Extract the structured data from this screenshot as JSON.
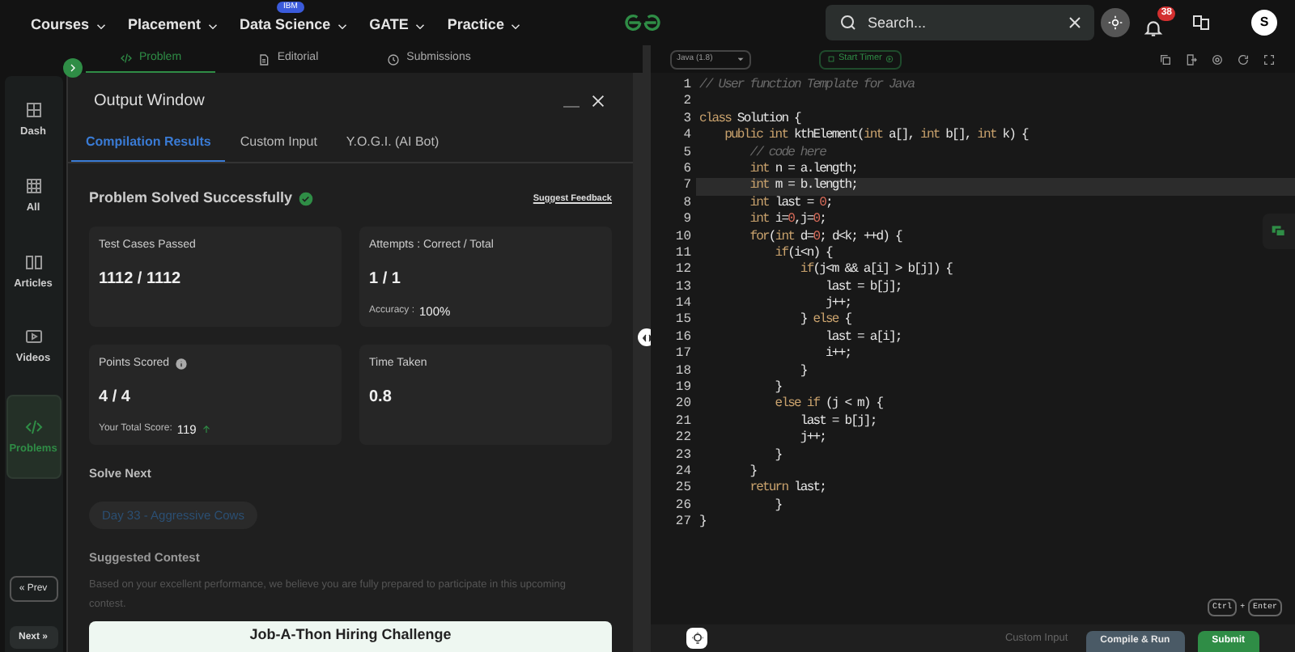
{
  "nav": {
    "items": [
      {
        "label": "Courses"
      },
      {
        "label": "Placement"
      },
      {
        "label": "Data Science",
        "badge": "IBM"
      },
      {
        "label": "GATE"
      },
      {
        "label": "Practice"
      }
    ],
    "search": {
      "placeholder": "Search..."
    },
    "notifications": "38",
    "avatar": "S"
  },
  "sidebar": {
    "items": [
      {
        "label": "Dash",
        "selected": false
      },
      {
        "label": "All",
        "selected": false
      },
      {
        "label": "Articles",
        "selected": false
      },
      {
        "label": "Videos",
        "selected": false
      },
      {
        "label": "Problems",
        "selected": true
      }
    ],
    "prev": "« Prev",
    "next": "Next »"
  },
  "problem_tabs": [
    {
      "label": "Problem",
      "selected": true
    },
    {
      "label": "Editorial",
      "selected": false
    },
    {
      "label": "Submissions",
      "selected": false
    }
  ],
  "output": {
    "title": "Output Window",
    "tabs": [
      {
        "label": "Compilation Results",
        "selected": true
      },
      {
        "label": "Custom Input",
        "selected": false
      },
      {
        "label": "Y.O.G.I. (AI Bot)",
        "selected": false
      }
    ],
    "status": "Problem Solved Successfully",
    "feedback": "Suggest Feedback",
    "cards": [
      {
        "label": "Test Cases Passed",
        "value": "1112 / 1112",
        "info": false
      },
      {
        "label": "Attempts : Correct / Total",
        "value": "1 / 1",
        "note": "Accuracy :",
        "note_value": "100%",
        "info": false
      },
      {
        "label": "Points Scored",
        "value": "4 / 4",
        "note": "Your Total Score:",
        "note_value": "119",
        "info": true
      },
      {
        "label": "Time Taken",
        "value": "0.8",
        "info": false
      }
    ],
    "solve_next_heading": "Solve Next",
    "solve_next": "Day 33 - Aggressive Cows",
    "contest_heading": "Suggested Contest",
    "contest_text": "Based on your excellent performance, we believe you are fully prepared to participate in this upcoming contest.",
    "contest_card": "Job-A-Thon Hiring Challenge"
  },
  "editor": {
    "language": "Java (1.8)",
    "timer": "Start Timer",
    "lines": [
      {
        "number": "1",
        "highlighted": false,
        "segments": [
          {
            "kind": "comment",
            "text": "// User function Template for Java"
          }
        ]
      },
      {
        "number": "2",
        "highlighted": false
      },
      {
        "number": "3",
        "highlighted": false,
        "segments": [
          {
            "kind": "keyword",
            "text": "class"
          },
          {
            "kind": "plain",
            "text": " Solution {"
          }
        ]
      },
      {
        "number": "4",
        "highlighted": false,
        "segments": [
          {
            "kind": "keyword",
            "text": "    public int"
          },
          {
            "kind": "plain",
            "text": " kthElement("
          },
          {
            "kind": "keyword",
            "text": "int"
          },
          {
            "kind": "plain",
            "text": " a[], "
          },
          {
            "kind": "keyword",
            "text": "int"
          },
          {
            "kind": "plain",
            "text": " b[], "
          },
          {
            "kind": "keyword",
            "text": "int"
          },
          {
            "kind": "plain",
            "text": " k) {"
          }
        ]
      },
      {
        "number": "5",
        "highlighted": false,
        "segments": [
          {
            "kind": "comment",
            "text": "        // code here"
          }
        ]
      },
      {
        "number": "6",
        "highlighted": false,
        "segments": [
          {
            "kind": "keyword",
            "text": "        int"
          },
          {
            "kind": "plain",
            "text": " n = a.length;"
          }
        ]
      },
      {
        "number": "7",
        "highlighted": true,
        "segments": [
          {
            "kind": "keyword",
            "text": "        int"
          },
          {
            "kind": "plain",
            "text": " m = b.length;"
          }
        ]
      },
      {
        "number": "8",
        "highlighted": false,
        "segments": [
          {
            "kind": "keyword",
            "text": "        int"
          },
          {
            "kind": "plain",
            "text": " last = "
          },
          {
            "kind": "number",
            "text": "0"
          },
          {
            "kind": "plain",
            "text": ";"
          }
        ]
      },
      {
        "number": "9",
        "highlighted": false,
        "segments": [
          {
            "kind": "keyword",
            "text": "        int"
          },
          {
            "kind": "plain",
            "text": " i="
          },
          {
            "kind": "number",
            "text": "0"
          },
          {
            "kind": "plain",
            "text": ",j="
          },
          {
            "kind": "number",
            "text": "0"
          },
          {
            "kind": "plain",
            "text": ";"
          }
        ]
      },
      {
        "number": "10",
        "highlighted": false,
        "segments": [
          {
            "kind": "keyword",
            "text": "        for"
          },
          {
            "kind": "plain",
            "text": "("
          },
          {
            "kind": "keyword",
            "text": "int"
          },
          {
            "kind": "plain",
            "text": " d="
          },
          {
            "kind": "number",
            "text": "0"
          },
          {
            "kind": "plain",
            "text": "; d<k; ++d) {"
          }
        ]
      },
      {
        "number": "11",
        "highlighted": false,
        "segments": [
          {
            "kind": "keyword",
            "text": "            if"
          },
          {
            "kind": "plain",
            "text": "(i<n) {"
          }
        ]
      },
      {
        "number": "12",
        "highlighted": false,
        "segments": [
          {
            "kind": "keyword",
            "text": "                if"
          },
          {
            "kind": "plain",
            "text": "(j<m && a[i] > b[j]) {"
          }
        ]
      },
      {
        "number": "13",
        "highlighted": false,
        "segments": [
          {
            "kind": "plain",
            "text": "                    last = b[j];"
          }
        ]
      },
      {
        "number": "14",
        "highlighted": false,
        "segments": [
          {
            "kind": "plain",
            "text": "                    j++;"
          }
        ]
      },
      {
        "number": "15",
        "highlighted": false,
        "segments": [
          {
            "kind": "plain",
            "text": "                } "
          },
          {
            "kind": "keyword",
            "text": "else"
          },
          {
            "kind": "plain",
            "text": " {"
          }
        ]
      },
      {
        "number": "16",
        "highlighted": false,
        "segments": [
          {
            "kind": "plain",
            "text": "                    last = a[i];"
          }
        ]
      },
      {
        "number": "17",
        "highlighted": false,
        "segments": [
          {
            "kind": "plain",
            "text": "                    i++;"
          }
        ]
      },
      {
        "number": "18",
        "highlighted": false,
        "segments": [
          {
            "kind": "plain",
            "text": "                }"
          }
        ]
      },
      {
        "number": "19",
        "highlighted": false,
        "segments": [
          {
            "kind": "plain",
            "text": "            }"
          }
        ]
      },
      {
        "number": "20",
        "highlighted": false,
        "segments": [
          {
            "kind": "keyword",
            "text": "            else if"
          },
          {
            "kind": "plain",
            "text": " (j < m) {"
          }
        ]
      },
      {
        "number": "21",
        "highlighted": false,
        "segments": [
          {
            "kind": "plain",
            "text": "                last = b[j];"
          }
        ]
      },
      {
        "number": "22",
        "highlighted": false,
        "segments": [
          {
            "kind": "plain",
            "text": "                j++;"
          }
        ]
      },
      {
        "number": "23",
        "highlighted": false,
        "segments": [
          {
            "kind": "plain",
            "text": "            }"
          }
        ]
      },
      {
        "number": "24",
        "highlighted": false,
        "segments": [
          {
            "kind": "plain",
            "text": "        }"
          }
        ]
      },
      {
        "number": "25",
        "highlighted": false,
        "segments": [
          {
            "kind": "keyword",
            "text": "        return"
          },
          {
            "kind": "plain",
            "text": " last;"
          }
        ]
      },
      {
        "number": "26",
        "highlighted": false,
        "segments": [
          {
            "kind": "plain",
            "text": "            }"
          }
        ]
      },
      {
        "number": "27",
        "highlighted": false,
        "segments": [
          {
            "kind": "plain",
            "text": "}"
          }
        ]
      }
    ],
    "shortcut": [
      "Ctrl",
      "+",
      "Enter"
    ],
    "custom_input": "Custom Input",
    "compile": "Compile & Run",
    "submit": "Submit"
  }
}
